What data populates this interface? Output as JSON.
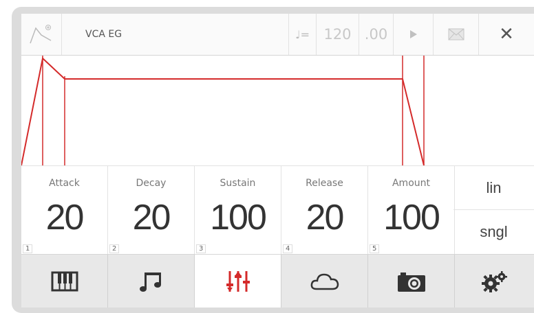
{
  "header": {
    "title": "VCA EG",
    "tempo_icon": "♩=",
    "tempo_integer": "120",
    "tempo_decimal": ".00",
    "close_label": "✕",
    "icons": [
      "envelope-logo-icon",
      "play-icon",
      "mail-icon",
      "close-icon"
    ]
  },
  "params": [
    {
      "label": "Attack",
      "value": "20",
      "index": "1"
    },
    {
      "label": "Decay",
      "value": "20",
      "index": "2"
    },
    {
      "label": "Sustain",
      "value": "100",
      "index": "3"
    },
    {
      "label": "Release",
      "value": "20",
      "index": "4"
    },
    {
      "label": "Amount",
      "value": "100",
      "index": "5"
    }
  ],
  "options": {
    "curve": "lin",
    "mode": "sngl"
  },
  "tabs": [
    {
      "icon": "keyboard-icon",
      "active": false
    },
    {
      "icon": "music-note-icon",
      "active": false
    },
    {
      "icon": "sliders-icon",
      "active": true
    },
    {
      "icon": "cloud-icon",
      "active": false
    },
    {
      "icon": "camera-icon",
      "active": false
    },
    {
      "icon": "gears-icon",
      "active": false
    }
  ],
  "colors": {
    "accent": "#d42a2a",
    "icon": "#333333",
    "frame": "#dcdcdc"
  }
}
